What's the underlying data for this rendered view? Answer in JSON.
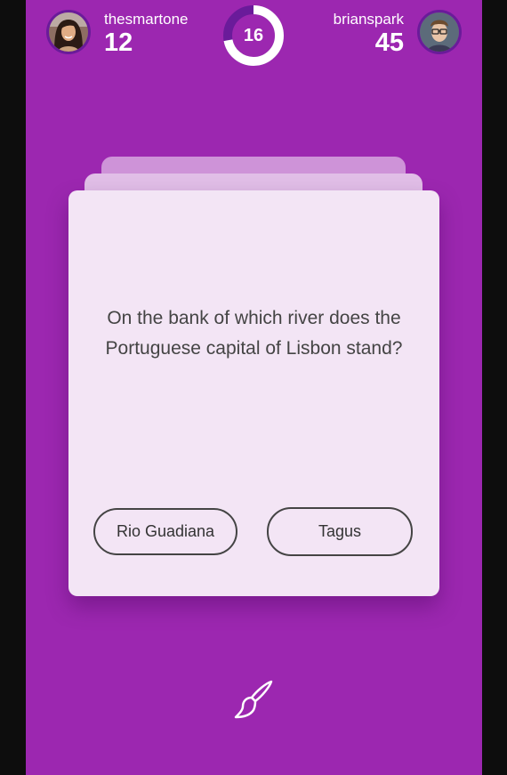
{
  "players": {
    "left": {
      "name": "thesmartone",
      "score": "12",
      "avatar_icon": "player-avatar-female"
    },
    "right": {
      "name": "brianspark",
      "score": "45",
      "avatar_icon": "player-avatar-male"
    }
  },
  "timer": {
    "value": "16",
    "remaining_fraction": 0.72
  },
  "question": {
    "text": "On the bank of which river does the Portuguese capital of Lisbon stand?"
  },
  "answers": [
    {
      "label": "Rio Guadiana"
    },
    {
      "label": "Tagus"
    }
  ],
  "category": {
    "icon": "paintbrush-icon"
  },
  "colors": {
    "background": "#9c27b0",
    "card": "#f3e5f5",
    "accent_dark": "#6a1b9a"
  }
}
